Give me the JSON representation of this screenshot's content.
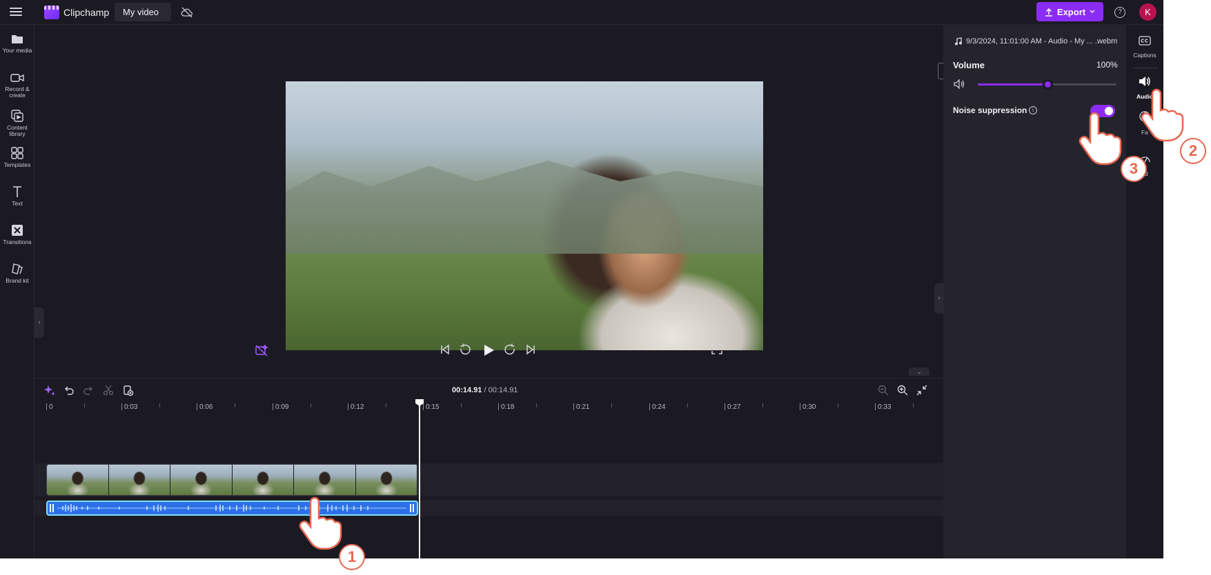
{
  "app": {
    "brand": "Clipchamp",
    "project_title": "My video",
    "export_label": "Export",
    "avatar_initial": "K"
  },
  "sidebar": {
    "items": [
      {
        "label": "Your media",
        "icon": "folder-icon"
      },
      {
        "label": "Record & create",
        "icon": "camera-icon"
      },
      {
        "label": "Content library",
        "icon": "library-icon"
      },
      {
        "label": "Templates",
        "icon": "templates-icon"
      },
      {
        "label": "Text",
        "icon": "text-icon"
      },
      {
        "label": "Transitions",
        "icon": "transitions-icon"
      },
      {
        "label": "Brand kit",
        "icon": "brand-kit-icon"
      }
    ]
  },
  "preview": {
    "aspect_ratio": "16:9"
  },
  "properties": {
    "file_name": "9/3/2024, 11:01:00 AM - Audio - My ... .webm",
    "volume_label": "Volume",
    "volume_value": "100%",
    "volume_level": 0.5,
    "noise_label": "Noise suppression",
    "noise_enabled": true
  },
  "rail": {
    "items": [
      {
        "label": "Captions",
        "icon": "captions-icon"
      },
      {
        "label": "Audio",
        "icon": "speaker-icon",
        "active": true
      },
      {
        "label": "Fa",
        "icon": "fade-icon"
      },
      {
        "label": "ed",
        "icon": "speed-icon"
      }
    ]
  },
  "timeline": {
    "current_time": "00:14.91",
    "separator": " / ",
    "duration": "00:14.91",
    "ruler_labels": [
      "0",
      "0:03",
      "0:06",
      "0:09",
      "0:12",
      "0:15",
      "0:18",
      "0:21",
      "0:24",
      "0:27",
      "0:30",
      "0:33"
    ]
  },
  "steps": [
    "1",
    "2",
    "3"
  ],
  "colors": {
    "accent": "#8b2cf5",
    "background": "#1b1a23",
    "panel": "#25242d",
    "audio_clip": "#2d6fe8",
    "step_marker": "#e8664f"
  }
}
